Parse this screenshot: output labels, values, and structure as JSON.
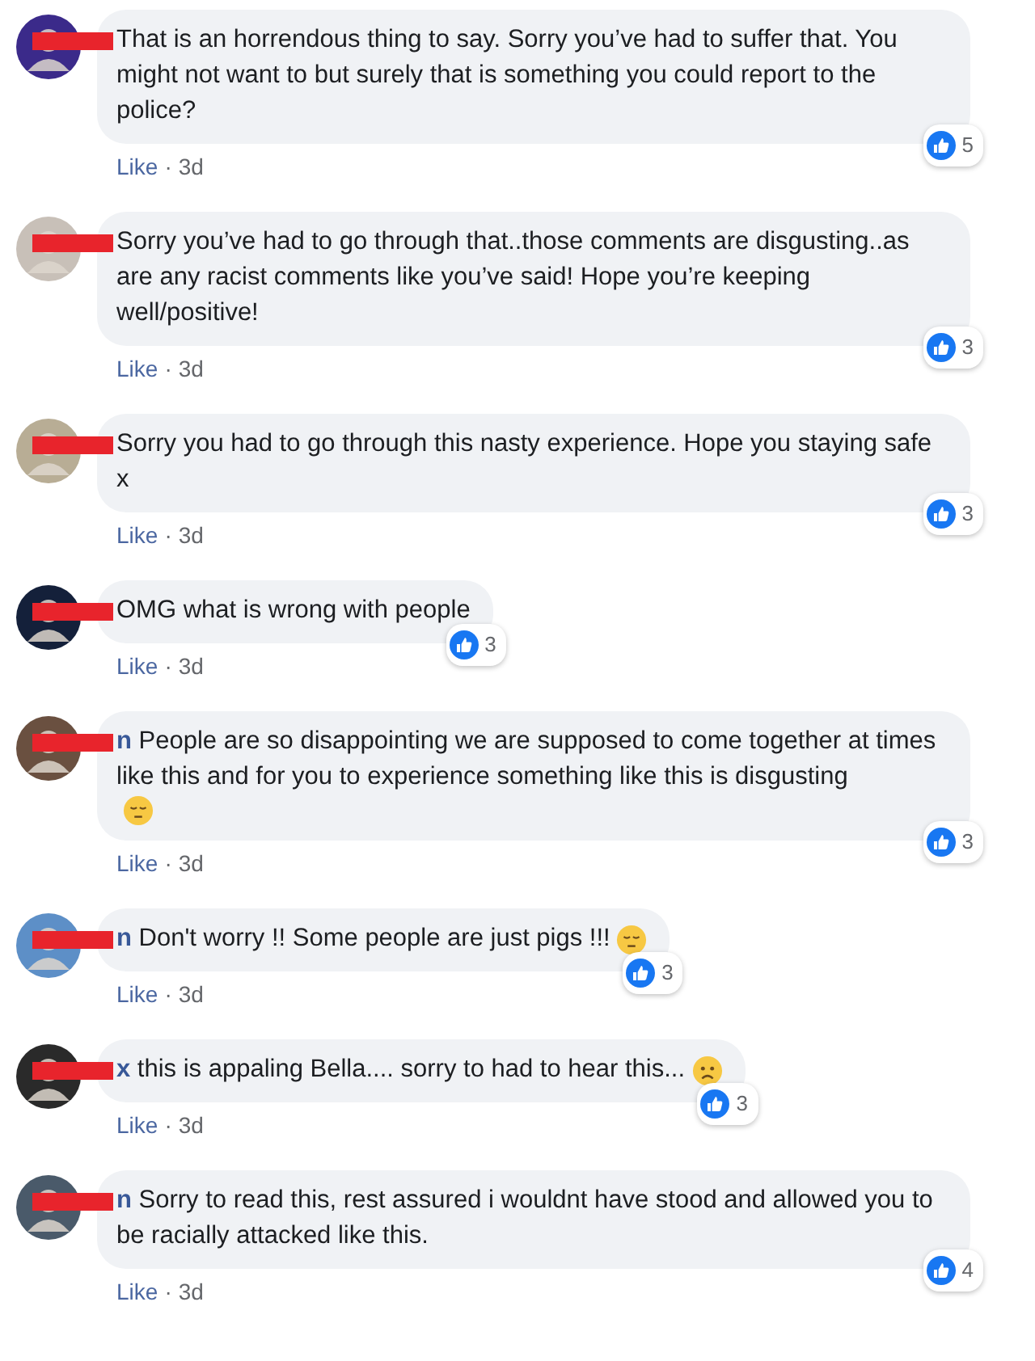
{
  "comments": [
    {
      "kind": "plain",
      "text": "That is an horrendous thing to say. Sorry you’ve had to suffer that. You might not want to but surely that is something you could report to the police?",
      "reactions": "5",
      "like": "Like",
      "separator": "·",
      "time": "3d"
    },
    {
      "kind": "plain",
      "text": "Sorry you’ve had to go through that..those comments are disgusting..as are any racist comments like you’ve said! Hope you’re keeping well/positive!",
      "reactions": "3",
      "like": "Like",
      "separator": "·",
      "time": "3d"
    },
    {
      "kind": "plain",
      "text": "Sorry you had to go through this nasty experience. Hope you staying safe x",
      "reactions": "3",
      "like": "Like",
      "separator": "·",
      "time": "3d"
    },
    {
      "kind": "plain",
      "text": "OMG what is wrong with people",
      "reactions": "3",
      "like": "Like",
      "separator": "·",
      "time": "3d"
    },
    {
      "kind": "pensive_emoji",
      "text": "**n** People are so disappointing we are supposed to come together at times like this and for you to experience something like this is disgusting",
      "reactions": "3",
      "like": "Like",
      "separator": "·",
      "time": "3d"
    },
    {
      "kind": "pensive_emoji",
      "text": "**n** Don't worry !! Some people are just pigs !!!",
      "reactions": "3",
      "like": "Like",
      "separator": "·",
      "time": "3d"
    },
    {
      "kind": "sad_emoji",
      "text": "**x** this is appaling Bella.... sorry to had to hear this...",
      "reactions": "3",
      "like": "Like",
      "separator": "·",
      "time": "3d"
    },
    {
      "kind": "plain",
      "text": "**n** Sorry to read this, rest assured i wouldnt have stood and allowed you to be racially attacked like this.",
      "reactions": "4",
      "like": "Like",
      "separator": "·",
      "time": "3d"
    }
  ]
}
